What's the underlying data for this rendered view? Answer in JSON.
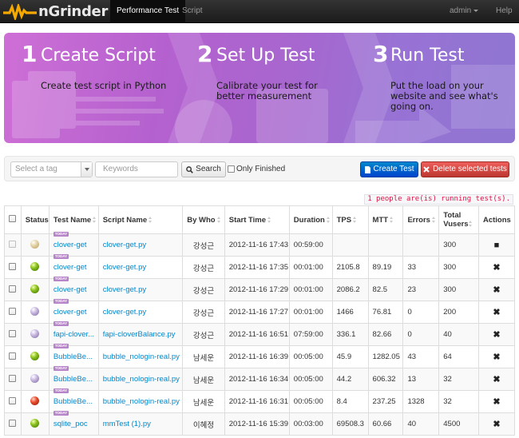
{
  "navbar": {
    "brand": "nGrinder",
    "items": [
      "Performance Test",
      "Script"
    ],
    "user": "admin",
    "help": "Help"
  },
  "banner": {
    "steps": [
      {
        "num": "1",
        "title": "Create Script",
        "desc": [
          "Create test script in Python"
        ]
      },
      {
        "num": "2",
        "title": "Set Up Test",
        "desc": [
          "Calibrate your test for",
          "better measurement"
        ]
      },
      {
        "num": "3",
        "title": "Run Test",
        "desc": [
          "Put the load on your",
          "website and see what's",
          "going on."
        ]
      }
    ]
  },
  "toolbar": {
    "tag_placeholder": "Select a tag",
    "keywords_placeholder": "Keywords",
    "search_label": "Search",
    "only_finished_label": "Only Finished",
    "create_label": "Create Test",
    "delete_label": "Delete selected tests"
  },
  "running_notice": "1 people are(is) running test(s).",
  "table": {
    "headers": [
      "Status",
      "Test Name",
      "Script Name",
      "By Who",
      "Start Time",
      "Duration",
      "TPS",
      "MTT",
      "Errors",
      "Total Vusers",
      "Actions"
    ],
    "today_badge": "TODAY",
    "rows": [
      {
        "status": "ready",
        "test": "clover-get",
        "script": "clover-get.py",
        "who": "강성근",
        "start": "2012-11-16 17:43",
        "duration": "00:59:00",
        "tps": "",
        "mtt": "",
        "errors": "",
        "vusers": "300",
        "action": "stop"
      },
      {
        "status": "green",
        "test": "clover-get",
        "script": "clover-get.py",
        "who": "강성근",
        "start": "2012-11-16 17:35",
        "duration": "00:01:00",
        "tps": "2105.8",
        "mtt": "89.19",
        "errors": "33",
        "vusers": "300",
        "action": "delete"
      },
      {
        "status": "green",
        "test": "clover-get",
        "script": "clover-get.py",
        "who": "강성근",
        "start": "2012-11-16 17:29",
        "duration": "00:01:00",
        "tps": "2086.2",
        "mtt": "82.5",
        "errors": "23",
        "vusers": "300",
        "action": "delete"
      },
      {
        "status": "purple",
        "test": "clover-get",
        "script": "clover-get.py",
        "who": "강성근",
        "start": "2012-11-16 17:27",
        "duration": "00:01:00",
        "tps": "1466",
        "mtt": "76.81",
        "errors": "0",
        "vusers": "200",
        "action": "delete"
      },
      {
        "status": "purple",
        "test": "fapi-clover...",
        "script": "fapi-cloverBalance.py",
        "who": "강성근",
        "start": "2012-11-16 16:51",
        "duration": "07:59:00",
        "tps": "336.1",
        "mtt": "82.66",
        "errors": "0",
        "vusers": "40",
        "action": "delete"
      },
      {
        "status": "green",
        "test": "BubbleBe...",
        "script": "bubble_nologin-real.py",
        "who": "남세운",
        "start": "2012-11-16 16:39",
        "duration": "00:05:00",
        "tps": "45.9",
        "mtt": "1282.05",
        "errors": "43",
        "vusers": "64",
        "action": "delete"
      },
      {
        "status": "purple",
        "test": "BubbleBe...",
        "script": "bubble_nologin-real.py",
        "who": "남세운",
        "start": "2012-11-16 16:34",
        "duration": "00:05:00",
        "tps": "44.2",
        "mtt": "606.32",
        "errors": "13",
        "vusers": "32",
        "action": "delete"
      },
      {
        "status": "red",
        "test": "BubbleBe...",
        "script": "bubble_nologin-real.py",
        "who": "남세운",
        "start": "2012-11-16 16:31",
        "duration": "00:05:00",
        "tps": "8.4",
        "mtt": "237.25",
        "errors": "1328",
        "vusers": "32",
        "action": "delete"
      },
      {
        "status": "green",
        "test": "sqlite_poc",
        "script": "mmTest (1).py",
        "who": "이혜정",
        "start": "2012-11-16 15:39",
        "duration": "00:03:00",
        "tps": "69508.3",
        "mtt": "60.66",
        "errors": "40",
        "vusers": "4500",
        "action": "delete"
      }
    ]
  },
  "colors": {
    "navbar_bg": "#222222",
    "primary_button": "#0055cc",
    "danger_button": "#da4f49",
    "link": "#0088cc",
    "running_text": "#dd1144"
  }
}
